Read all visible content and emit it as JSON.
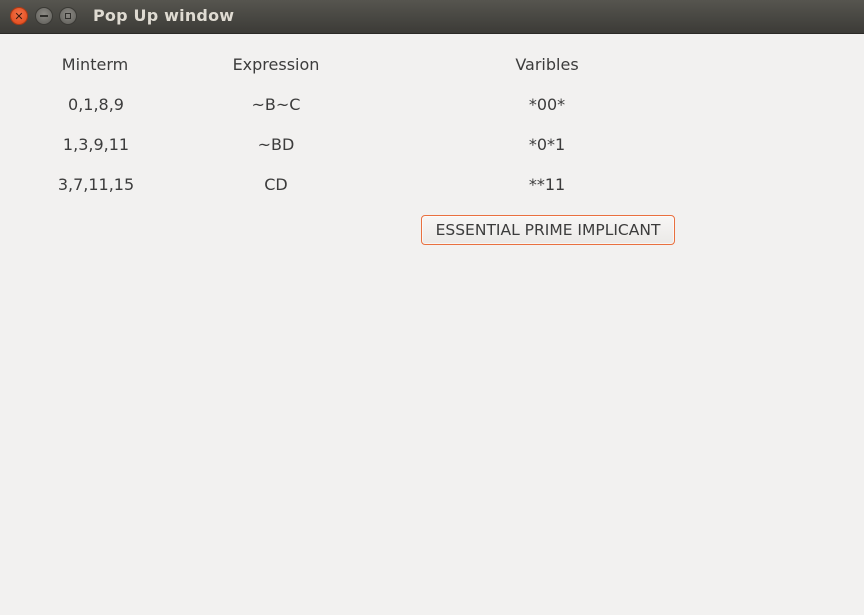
{
  "window": {
    "title": "Pop Up window",
    "controls": {
      "close_icon": "close-icon",
      "minimize_icon": "minimize-icon",
      "maximize_icon": "maximize-icon"
    }
  },
  "table": {
    "headers": {
      "minterm": "Minterm",
      "expression": "Expression",
      "variables": "Varibles"
    },
    "rows": [
      {
        "minterm": "0,1,8,9",
        "expression": "~B~C",
        "variables": "*00*"
      },
      {
        "minterm": "1,3,9,11",
        "expression": "~BD",
        "variables": "*0*1"
      },
      {
        "minterm": "3,7,11,15",
        "expression": "CD",
        "variables": "**11"
      }
    ]
  },
  "button": {
    "label": "ESSENTIAL PRIME IMPLICANT"
  },
  "colors": {
    "titlebar": "#3c3b37",
    "background": "#f2f1f0",
    "button_focus_border": "#e9703f",
    "close_button": "#de4415"
  }
}
